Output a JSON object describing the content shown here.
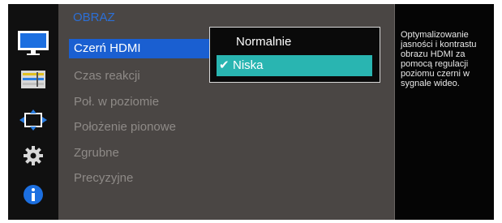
{
  "menu": {
    "title": "OBRAZ",
    "items": [
      {
        "label": "Czerń HDMI",
        "selected": true
      },
      {
        "label": "Czas reakcji",
        "selected": false
      },
      {
        "label": "Poł. w poziomie",
        "selected": false
      },
      {
        "label": "Położenie pionowe",
        "selected": false
      },
      {
        "label": "Zgrubne",
        "selected": false
      },
      {
        "label": "Precyzyjne",
        "selected": false
      }
    ]
  },
  "dropdown": {
    "options": [
      {
        "label": "Normalnie",
        "checked": false
      },
      {
        "label": "Niska",
        "checked": true
      }
    ],
    "check_glyph": "✔"
  },
  "description": "Optymalizowanie jasności i kontrastu obrazu HDMI za pomocą regulacji poziomu czerni w sygnale wideo.",
  "sidebar_icons": [
    "monitor-icon",
    "color-bars-icon",
    "resize-arrows-icon",
    "gear-icon",
    "info-icon"
  ],
  "colors": {
    "selected_item": "#1a5fd1",
    "selected_option": "#29b5b1",
    "title": "#2c6fd6",
    "panel": "#4a4644"
  }
}
